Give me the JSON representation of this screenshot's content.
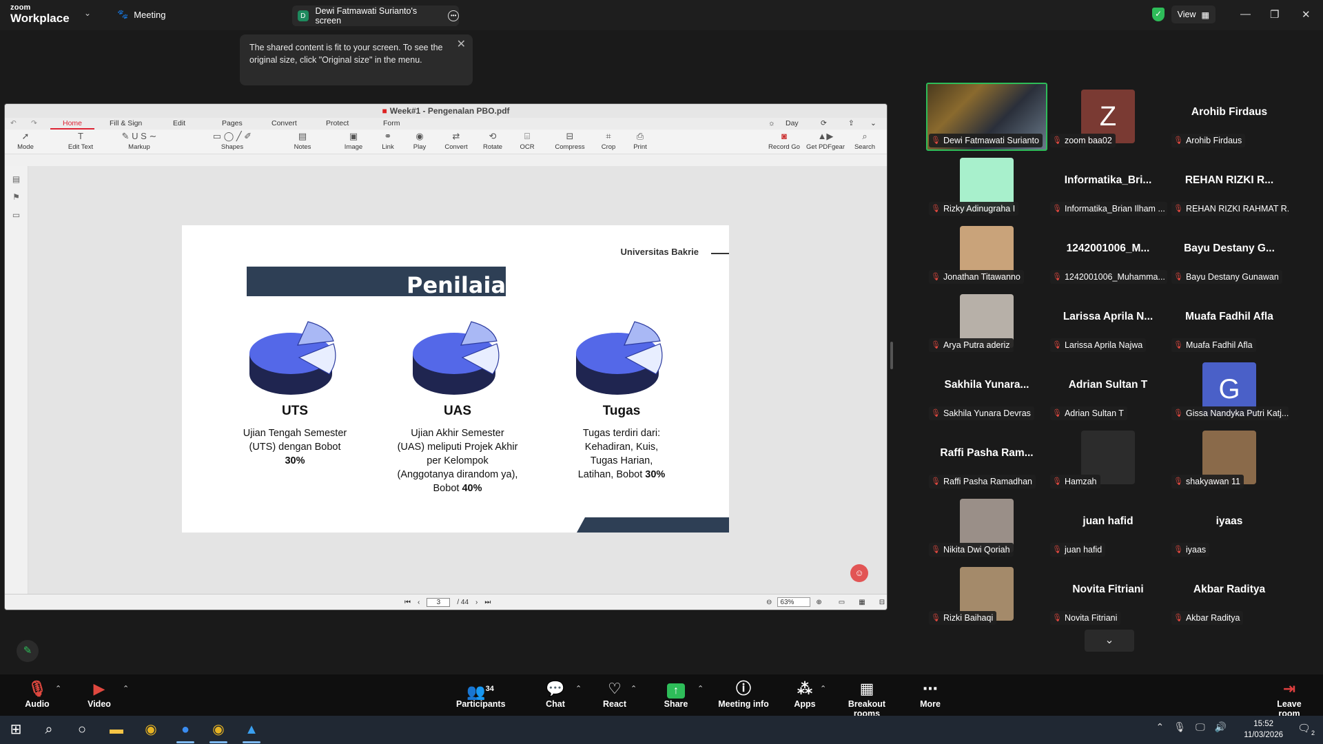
{
  "topbar": {
    "brand_line1": "zoom",
    "brand_line2": "Workplace",
    "meeting_label": "Meeting",
    "screen_tab_initial": "D",
    "screen_tab_label": "Dewi Fatmawati Surianto's screen",
    "view_label": "View",
    "icons": [
      "chevron-down-icon",
      "meeting-icon",
      "more-icon",
      "shield-check-icon",
      "grid-icon",
      "minimize-icon",
      "maximize-icon",
      "close-icon"
    ]
  },
  "tooltip": {
    "text": "The shared content is fit to your screen. To see the original size, click \"Original size\" in the menu."
  },
  "pdf": {
    "title": "Week#1 - Pengenalan PBO.pdf",
    "tabs": [
      "Home",
      "Fill & Sign",
      "Edit",
      "Pages",
      "Convert",
      "Protect",
      "Form"
    ],
    "day_mode": "Day",
    "ribbon": [
      "Mode",
      "Edit Text",
      "Markup",
      "Shapes",
      "Notes",
      "Image",
      "Link",
      "Play",
      "Convert",
      "Rotate",
      "OCR",
      "Compress",
      "Crop",
      "Print"
    ],
    "ribbon_right": [
      "Record Go",
      "Get PDFgear",
      "Search"
    ],
    "page_current": "3",
    "page_total": "/ 44",
    "zoom": "63%"
  },
  "slide": {
    "university": "Universitas Bakrie",
    "title": "Penilaian",
    "columns": [
      {
        "title": "UTS",
        "desc_lines": [
          "Ujian Tengah Semester",
          "(UTS) dengan Bobot"
        ],
        "bold_line": "30%"
      },
      {
        "title": "UAS",
        "desc_lines": [
          "Ujian Akhir Semester",
          "(UAS) meliputi Projek Akhir",
          "per Kelompok",
          "(Anggotanya dirandom ya),"
        ],
        "pre_bold": "Bobot ",
        "bold_line": "40%"
      },
      {
        "title": "Tugas",
        "desc_lines": [
          "Tugas terdiri dari:",
          "Kehadiran, Kuis,",
          "Tugas Harian,"
        ],
        "pre_bold": "Latihan, Bobot ",
        "bold_line": "30%"
      }
    ]
  },
  "participants": [
    {
      "name": "Dewi Fatmawati Surianto",
      "kind": "video",
      "active": true
    },
    {
      "name": "zoom baa02",
      "kind": "letter",
      "letter": "Z",
      "color": "#7a3a33"
    },
    {
      "name": "Arohib Firdaus",
      "kind": "text",
      "big": "Arohib Firdaus"
    },
    {
      "name": "Rizky Adinugraha I",
      "kind": "swatch",
      "color": "#a8f0cc"
    },
    {
      "name": "Informatika_Brian Ilham ...",
      "kind": "text",
      "big": "Informatika_Bri..."
    },
    {
      "name": "REHAN RIZKI RAHMAT R...",
      "kind": "text",
      "big": "REHAN RIZKI R..."
    },
    {
      "name": "Jonathan Titawanno",
      "kind": "photo",
      "color": "#c9a37a"
    },
    {
      "name": "1242001006_Muhamma...",
      "kind": "text",
      "big": "1242001006_M..."
    },
    {
      "name": "Bayu Destany Gunawan",
      "kind": "text",
      "big": "Bayu Destany G..."
    },
    {
      "name": "Arya Putra aderiz",
      "kind": "photo",
      "color": "#b7b0a8"
    },
    {
      "name": "Larissa Aprila Najwa",
      "kind": "text",
      "big": "Larissa Aprila N..."
    },
    {
      "name": "Muafa Fadhil Afla",
      "kind": "text",
      "big": "Muafa Fadhil Afla"
    },
    {
      "name": "Sakhila Yunara Devras",
      "kind": "text",
      "big": "Sakhila Yunara..."
    },
    {
      "name": "Adrian Sultan T",
      "kind": "text",
      "big": "Adrian Sultan T"
    },
    {
      "name": "Gissa Nandyka Putri Katj...",
      "kind": "letter",
      "letter": "G",
      "color": "#4a60c8"
    },
    {
      "name": "Raffi Pasha Ramadhan",
      "kind": "text",
      "big": "Raffi Pasha Ram..."
    },
    {
      "name": "Hamzah",
      "kind": "photo",
      "color": "#2c2c2c"
    },
    {
      "name": "shakyawan 11",
      "kind": "photo",
      "color": "#8a6a4a"
    },
    {
      "name": "Nikita Dwi Qoriah",
      "kind": "photo",
      "color": "#9a8f88"
    },
    {
      "name": "juan hafid",
      "kind": "text",
      "big": "juan hafid"
    },
    {
      "name": "iyaas",
      "kind": "text",
      "big": "iyaas"
    },
    {
      "name": "Rizki Baihaqi",
      "kind": "photo",
      "color": "#a48a6a"
    },
    {
      "name": "Novita Fitriani",
      "kind": "text",
      "big": "Novita Fitriani"
    },
    {
      "name": "Akbar Raditya",
      "kind": "text",
      "big": "Akbar Raditya"
    }
  ],
  "toolbar": {
    "audio": "Audio",
    "video": "Video",
    "participants": "Participants",
    "participants_count": "34",
    "chat": "Chat",
    "react": "React",
    "share": "Share",
    "meeting_info": "Meeting info",
    "apps": "Apps",
    "breakout": "Breakout rooms",
    "more": "More",
    "leave": "Leave room"
  },
  "taskbar": {
    "time": "15:52",
    "date": "11/03/2026",
    "notifications": "2"
  },
  "colors": {
    "accent_green": "#2ebd59",
    "mute_red": "#e0483f",
    "slide_navy": "#2e3f55",
    "pie_blue": "#5468e8"
  }
}
